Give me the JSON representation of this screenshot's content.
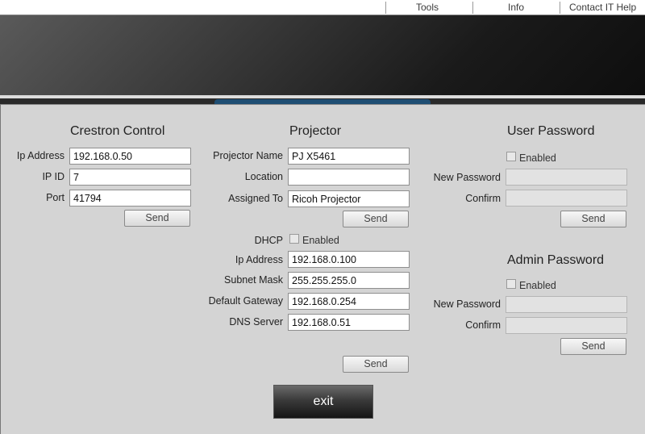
{
  "nav": {
    "tools": "Tools",
    "info": "Info",
    "contact": "Contact IT Help"
  },
  "crestron": {
    "title": "Crestron Control",
    "ip_label": "Ip Address",
    "ip_value": "192.168.0.50",
    "ipid_label": "IP ID",
    "ipid_value": "7",
    "port_label": "Port",
    "port_value": "41794",
    "send_label": "Send"
  },
  "projector": {
    "title": "Projector",
    "name_label": "Projector Name",
    "name_value": "PJ X5461",
    "location_label": "Location",
    "location_value": "",
    "assigned_label": "Assigned To",
    "assigned_value": "Ricoh Projector",
    "send_label": "Send",
    "dhcp_label": "DHCP",
    "dhcp_enabled_label": "Enabled",
    "ip_label": "Ip Address",
    "ip_value": "192.168.0.100",
    "subnet_label": "Subnet Mask",
    "subnet_value": "255.255.255.0",
    "gateway_label": "Default Gateway",
    "gateway_value": "192.168.0.254",
    "dns_label": "DNS Server",
    "dns_value": "192.168.0.51",
    "send2_label": "Send"
  },
  "user_password": {
    "title": "User Password",
    "enabled_label": "Enabled",
    "new_label": "New Password",
    "new_value": "",
    "confirm_label": "Confirm",
    "confirm_value": "",
    "send_label": "Send"
  },
  "admin_password": {
    "title": "Admin Password",
    "enabled_label": "Enabled",
    "new_label": "New Password",
    "new_value": "",
    "confirm_label": "Confirm",
    "confirm_value": "",
    "send_label": "Send"
  },
  "exit_label": "exit",
  "colors": {
    "tab_accent": "#1f4e73",
    "panel_bg": "#d4d4d4"
  }
}
